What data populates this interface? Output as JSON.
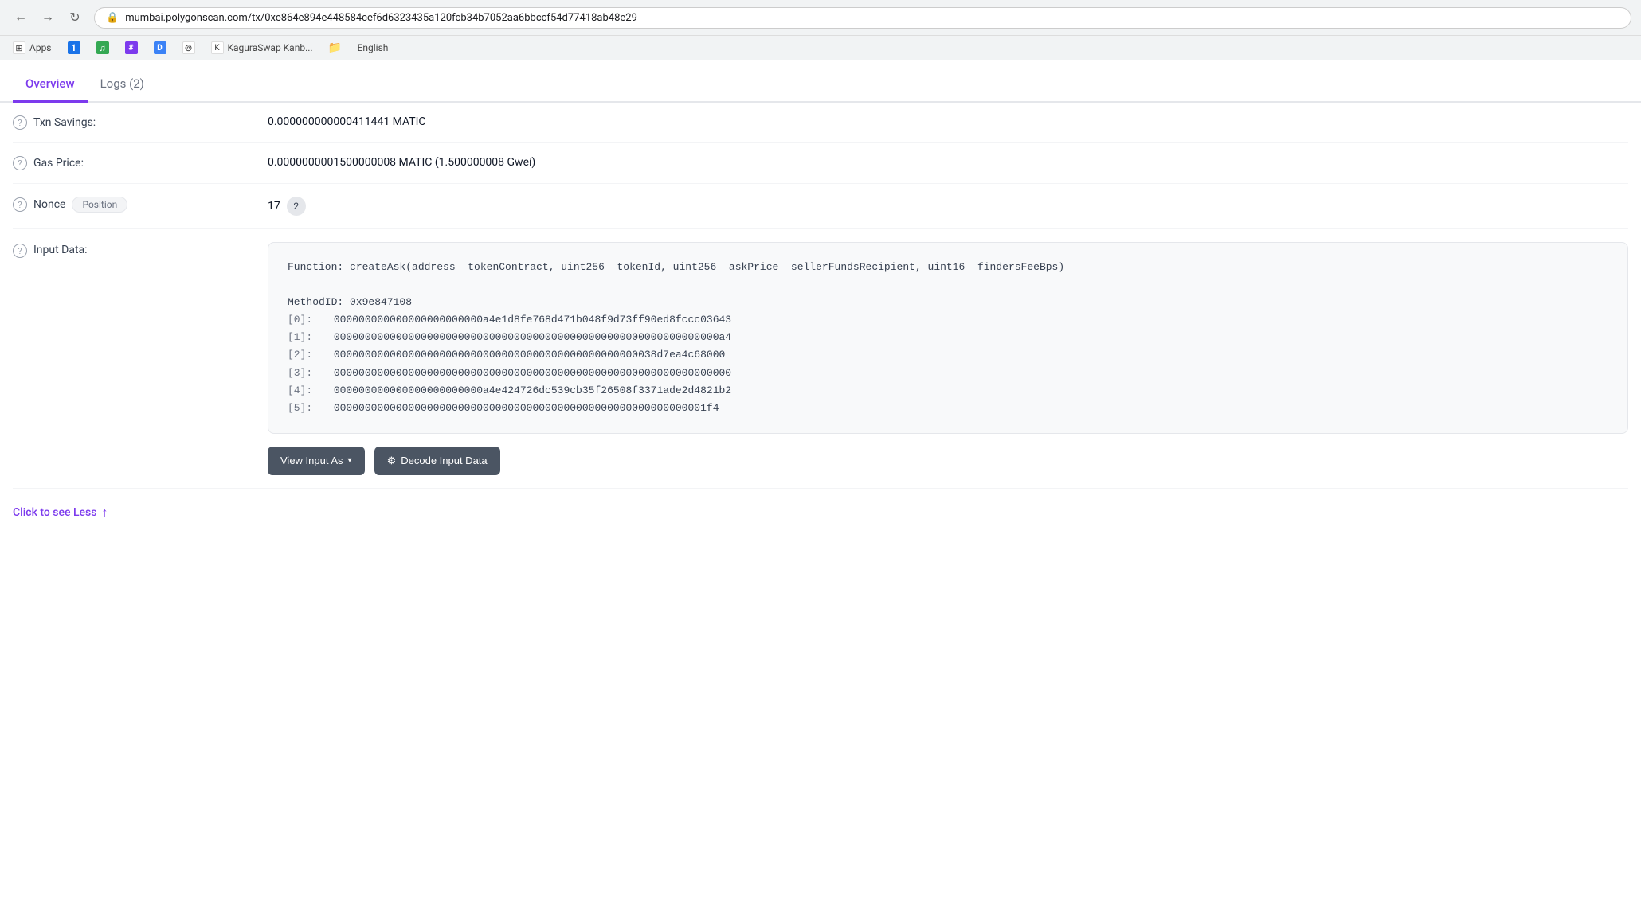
{
  "browser": {
    "url": "mumbai.polygonscan.com/tx/0xe864e894e448584cef6d6323435a120fcb34b7052aa6bbccf54d77418ab48e29",
    "bookmarks": [
      {
        "id": "apps",
        "label": "Apps",
        "iconText": "⊞",
        "iconClass": "icon-white"
      },
      {
        "id": "lastpass",
        "label": "",
        "iconText": "1",
        "iconClass": "icon-blue"
      },
      {
        "id": "spotify",
        "label": "",
        "iconText": "♫",
        "iconClass": "icon-green"
      },
      {
        "id": "slack",
        "label": "",
        "iconText": "#",
        "iconClass": "icon-purple"
      },
      {
        "id": "discord",
        "label": "",
        "iconText": "D",
        "iconClass": "icon-indigo"
      },
      {
        "id": "github",
        "label": "",
        "iconText": "⊚",
        "iconClass": "icon-white"
      },
      {
        "id": "kagura",
        "label": "KaguraSwap Kanb...",
        "iconText": "K",
        "iconClass": "icon-white"
      },
      {
        "id": "folder",
        "label": "",
        "iconText": "📁",
        "iconClass": "icon-folder"
      },
      {
        "id": "english",
        "label": "English",
        "iconText": "",
        "iconClass": "icon-white"
      }
    ]
  },
  "tabs": [
    {
      "id": "overview",
      "label": "Overview",
      "active": true
    },
    {
      "id": "logs",
      "label": "Logs (2)",
      "active": false
    }
  ],
  "rows": [
    {
      "id": "txn-savings",
      "label": "Txn Savings:",
      "value": "0.000000000000411441 MATIC",
      "hasHelp": true
    },
    {
      "id": "gas-price",
      "label": "Gas Price:",
      "value": "0.0000000001500000008 MATIC (1.500000008 Gwei)",
      "hasHelp": true
    }
  ],
  "nonce": {
    "label": "Nonce",
    "positionBadgeLabel": "Position",
    "value": "17",
    "positionValue": "2",
    "hasHelp": true
  },
  "inputData": {
    "label": "Input Data:",
    "hasHelp": true,
    "functionSignature": "Function: createAsk(address _tokenContract, uint256 _tokenId, uint256 _askPrice _sellerFundsRecipient, uint16 _findersFeeBps)",
    "methodId": "MethodID: 0x9e847108",
    "lines": [
      {
        "index": "[0]:",
        "value": "000000000000000000000000a4e1d8fe768d471b048f9d73ff90ed8fccc03643"
      },
      {
        "index": "[1]:",
        "value": "00000000000000000000000000000000000000000000000000000000000000a4"
      },
      {
        "index": "[2]:",
        "value": "0000000000000000000000000000000000000000000000000038d7ea4c68000"
      },
      {
        "index": "[3]:",
        "value": "0000000000000000000000000000000000000000000000000000000000000000"
      },
      {
        "index": "[4]:",
        "value": "000000000000000000000000a4e424726dc539cb35f26508f3371ade2d4821b2"
      },
      {
        "index": "[5]:",
        "value": "000000000000000000000000000000000000000000000000000000000001f4"
      }
    ],
    "viewInputLabel": "View Input As",
    "decodeInputLabel": "Decode Input Data"
  },
  "seeLess": {
    "label": "Click to see Less"
  }
}
